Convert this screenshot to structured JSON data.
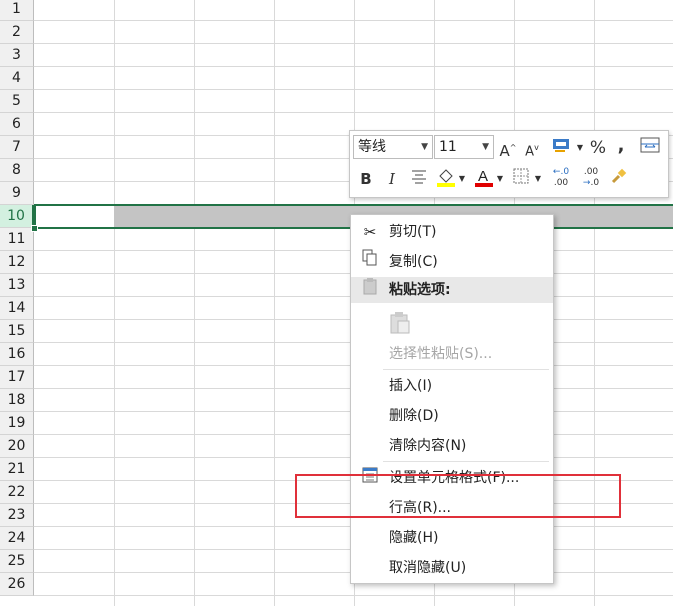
{
  "sheet": {
    "row_numbers": [
      "1",
      "2",
      "3",
      "4",
      "5",
      "6",
      "7",
      "8",
      "9",
      "10",
      "11",
      "12",
      "13",
      "14",
      "15",
      "16",
      "17",
      "18",
      "19",
      "20",
      "21",
      "22",
      "23",
      "24",
      "25",
      "26"
    ],
    "selected_row": "10"
  },
  "mini_toolbar": {
    "font_name": "等线",
    "font_size": "11",
    "increase_font_icon": "A",
    "decrease_font_icon": "A",
    "percent_label": "%",
    "comma_label": ",",
    "bold_label": "B",
    "italic_label": "I",
    "increase_decimal_label": ".00",
    "decrease_decimal_label": ".0",
    "fill_color": "#ffff00",
    "font_color": "#e00000"
  },
  "context_menu": {
    "items": [
      {
        "label": "剪切(T)",
        "icon": "scissors-icon",
        "enabled": true
      },
      {
        "label": "复制(C)",
        "icon": "copy-icon",
        "enabled": true
      },
      {
        "label": "粘贴选项:",
        "icon": "paste-icon",
        "enabled": false,
        "header": true
      },
      {
        "label": "",
        "icon": "paste-icon",
        "enabled": false
      },
      {
        "label": "选择性粘贴(S)...",
        "icon": "",
        "enabled": false
      },
      {
        "label": "插入(I)",
        "icon": "",
        "enabled": true
      },
      {
        "label": "删除(D)",
        "icon": "",
        "enabled": true
      },
      {
        "label": "清除内容(N)",
        "icon": "",
        "enabled": true
      },
      {
        "label": "设置单元格格式(F)...",
        "icon": "format-cells-icon",
        "enabled": true
      },
      {
        "label": "行高(R)...",
        "icon": "",
        "enabled": true
      },
      {
        "label": "隐藏(H)",
        "icon": "",
        "enabled": true
      },
      {
        "label": "取消隐藏(U)",
        "icon": "",
        "enabled": true
      }
    ]
  },
  "highlight_color": "#e0303a",
  "accent_color": "#217346"
}
